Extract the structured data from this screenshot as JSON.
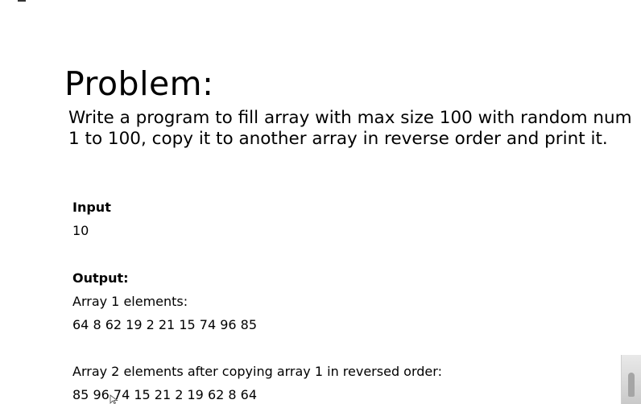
{
  "problem": {
    "title": "Problem:",
    "statement_line1": "Write a program to fill array with max size 100 with random num",
    "statement_line2": "1 to 100, copy it to another array in reverse order and print it."
  },
  "input": {
    "heading": "Input",
    "value": "10"
  },
  "output": {
    "heading": "Output:",
    "array1_label": "Array 1 elements:",
    "array1_values": "64 8 62 19 2 21 15 74 96 85",
    "array2_label": "Array 2 elements after copying array 1 in reversed order:",
    "array2_values": "85 96 74 15 21 2 19 62 8 64"
  },
  "icons": {
    "cursor": "mouse-pointer-icon"
  }
}
